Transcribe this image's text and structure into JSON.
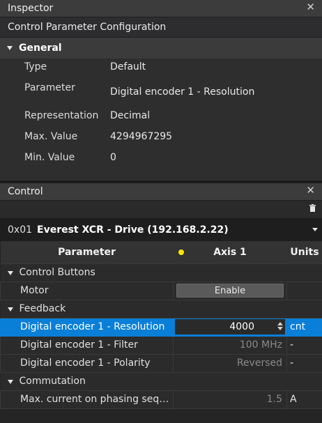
{
  "inspector": {
    "title": "Inspector",
    "subtitle": "Control Parameter Configuration",
    "group": "General",
    "properties": [
      {
        "label": "Type",
        "value": "Default"
      },
      {
        "label": "Parameter",
        "value": "Digital encoder 1 - Resolution"
      },
      {
        "label": "Representation",
        "value": "Decimal"
      },
      {
        "label": "Max. Value",
        "value": "4294967295"
      },
      {
        "label": "Min. Value",
        "value": "0"
      }
    ]
  },
  "control": {
    "title": "Control",
    "drive": {
      "id": "0x01",
      "name": "Everest XCR - Drive (192.168.2.22)"
    },
    "table": {
      "col_parameter": "Parameter",
      "col_axis": "Axis 1",
      "col_units": "Units",
      "axis_status_color": "#ffe600",
      "cat_control_buttons": "Control Buttons",
      "motor_label": "Motor",
      "enable_label": "Enable",
      "cat_feedback": "Feedback",
      "rows": [
        {
          "name": "Digital encoder 1 - Resolution",
          "value": "4000",
          "unit": "cnt"
        },
        {
          "name": "Digital encoder 1 - Filter",
          "value": "100 MHz",
          "unit": "-"
        },
        {
          "name": "Digital encoder 1 - Polarity",
          "value": "Reversed",
          "unit": "-"
        }
      ],
      "cat_commutation": "Commutation",
      "phasing_row": {
        "name": "Max. current on phasing seque...",
        "value": "1.5",
        "unit": "A"
      }
    }
  },
  "colors": {
    "selection": "#0a7fd8",
    "background": "#252526"
  }
}
